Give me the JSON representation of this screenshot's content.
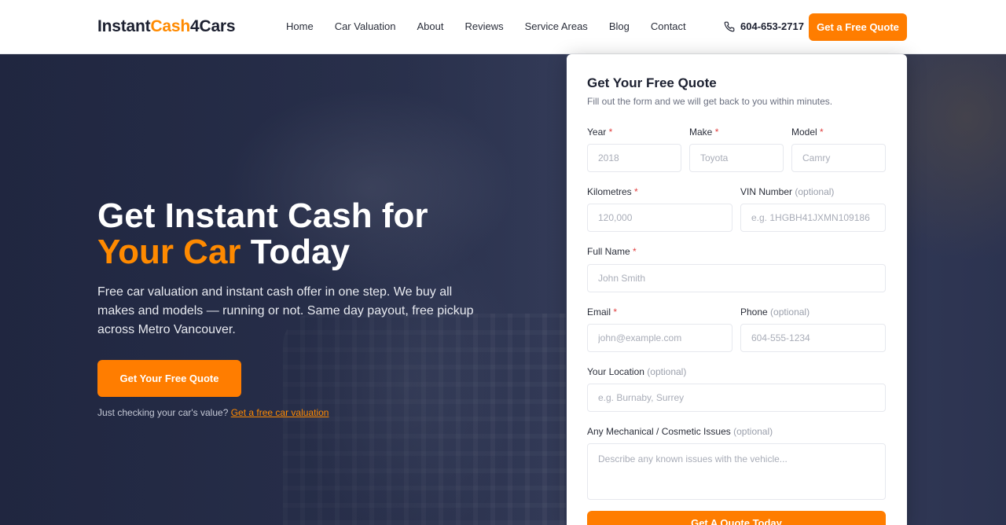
{
  "header": {
    "logo_part1": "Instant",
    "logo_part2": "Cash",
    "logo_part3": "4Cars",
    "nav": [
      "Home",
      "Car Valuation",
      "About",
      "Reviews",
      "Service Areas",
      "Blog",
      "Contact"
    ],
    "phone": "604-653-2717",
    "cta": "Get a Free Quote"
  },
  "hero": {
    "title_line1": "Get Instant Cash for",
    "title_accent": "Your Car",
    "title_rest": "Today",
    "description": "Free car valuation and instant cash offer in one step. We buy all makes and models — running or not. Same day payout, free pickup across Metro Vancouver.",
    "cta": "Get Your Free Quote",
    "note": "Just checking your car's value?",
    "note_link": "Get a free car valuation"
  },
  "form": {
    "title": "Get Your Free Quote",
    "subtitle": "Fill out the form and we will get back to you within minutes.",
    "required_mark": "*",
    "optional_mark": "(optional)",
    "fields": {
      "year": {
        "label": "Year",
        "placeholder": "2018"
      },
      "make": {
        "label": "Make",
        "placeholder": "Toyota"
      },
      "model": {
        "label": "Model",
        "placeholder": "Camry"
      },
      "kilometres": {
        "label": "Kilometres",
        "placeholder": "120,000"
      },
      "vin": {
        "label": "VIN Number",
        "placeholder": "e.g. 1HGBH41JXMN109186"
      },
      "full_name": {
        "label": "Full Name",
        "placeholder": "John Smith"
      },
      "email": {
        "label": "Email",
        "placeholder": "john@example.com"
      },
      "phone": {
        "label": "Phone",
        "placeholder": "604-555-1234"
      },
      "location": {
        "label": "Your Location",
        "placeholder": "e.g. Burnaby, Surrey"
      },
      "issues": {
        "label": "Any Mechanical / Cosmetic Issues",
        "placeholder": "Describe any known issues with the vehicle..."
      }
    },
    "submit": "Get A Quote Today"
  },
  "colors": {
    "accent": "#ff7d00",
    "dark": "#1c2030",
    "required": "#e04040"
  }
}
